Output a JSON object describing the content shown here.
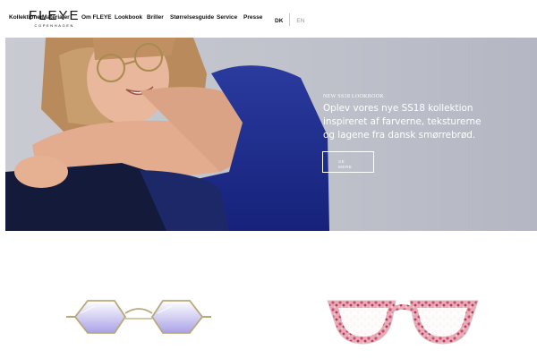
{
  "brand": {
    "name": "FLEYE",
    "tagline": "COPENHAGEN"
  },
  "nav": {
    "items": [
      {
        "label": "Kollektioner"
      },
      {
        "label": "Materialer"
      },
      {
        "label": "Om FLEYE"
      },
      {
        "label": "Lookbook"
      },
      {
        "label": "Briller"
      },
      {
        "label": "Størrelsesguide"
      },
      {
        "label": "Service"
      },
      {
        "label": "Presse"
      }
    ]
  },
  "language": {
    "active": "DK",
    "inactive": "EN"
  },
  "hero": {
    "eyebrow": "NEW SS18 LOOKBOOK",
    "headline_lines": [
      "Oplev vores nye SS18 kollektion",
      "inspireret af farverne, teksturerne",
      "og lagene fra dansk smørrebrød."
    ],
    "cta_lines": [
      "SE",
      "MERE"
    ]
  },
  "products": [
    {
      "icon": "gold-hexagon-sunglasses-icon",
      "lens_color": "#a9a2e6"
    },
    {
      "icon": "pink-tortoise-cat-eye-glasses-icon",
      "frame_color": "#c9506e"
    }
  ]
}
